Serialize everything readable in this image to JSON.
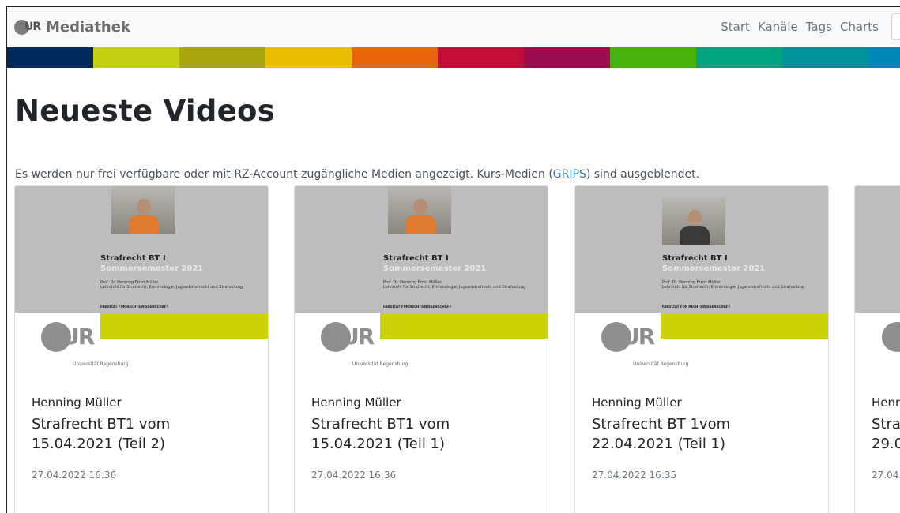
{
  "navbar": {
    "brand_logo_text": "UR",
    "brand": "Mediathek",
    "links": [
      "Start",
      "Kanäle",
      "Tags",
      "Charts"
    ]
  },
  "colors": {
    "stripes": [
      "#00285a",
      "#c6d012",
      "#a9a50c",
      "#ebbd00",
      "#e9650c",
      "#c40c3b",
      "#9b0d4c",
      "#48b30f",
      "#00a37d",
      "#00929a",
      "#0087b9"
    ],
    "link": "#2a7ac0",
    "slide_accent": "#cdd309"
  },
  "page": {
    "heading": "Neueste Videos",
    "info_before": "Es werden nur frei verfügbare oder mit RZ-Account zugängliche Medien angezeigt. Kurs-Medien (",
    "info_link": "GRIPS",
    "info_after": ") sind ausgeblendet."
  },
  "cards": [
    {
      "thumb": {
        "title": "Strafrecht BT I",
        "semester": "Sommersemester 2021",
        "prof": "Prof. Dr. Henning Ernst Müller",
        "chair": "Lehrstuhl für Strafrecht, Kriminologie, Jugendstrafrecht und Strafvollzug",
        "faculty": "FAKULTÄT FÜR RECHTSWISSENSCHAFT",
        "logo": "UR",
        "university": "Universität Regensburg"
      },
      "author": "Henning Müller",
      "title": "Strafrecht BT1 vom 15.04.2021 (Teil 2)",
      "date": "27.04.2022 16:36"
    },
    {
      "thumb": {
        "title": "Strafrecht BT I",
        "semester": "Sommersemester 2021",
        "prof": "Prof. Dr. Henning Ernst Müller",
        "chair": "Lehrstuhl für Strafrecht, Kriminologie, Jugendstrafrecht und Strafvollzug",
        "faculty": "FAKULTÄT FÜR RECHTSWISSENSCHAFT",
        "logo": "UR",
        "university": "Universität Regensburg"
      },
      "author": "Henning Müller",
      "title": "Strafrecht BT1 vom 15.04.2021 (Teil 1)",
      "date": "27.04.2022 16:36"
    },
    {
      "thumb": {
        "title": "Strafrecht BT I",
        "semester": "Sommersemester 2021",
        "prof": "Prof. Dr. Henning Ernst Müller",
        "chair": "Lehrstuhl für Strafrecht, Kriminologie, Jugendstrafrecht und Strafvollzug",
        "faculty": "FAKULTÄT FÜR RECHTSWISSENSCHAFT",
        "logo": "UR",
        "university": "Universität Regensburg"
      },
      "author": "Henning Müller",
      "title": "Strafrecht BT 1vom 22.04.2021 (Teil 1)",
      "date": "27.04.2022 16:35"
    },
    {
      "thumb": {
        "title": "",
        "semester": "",
        "prof": "",
        "chair": "",
        "faculty": "",
        "logo": "",
        "university": ""
      },
      "author": "Henn",
      "title": "Stra 29.0",
      "date": "27.04."
    }
  ]
}
